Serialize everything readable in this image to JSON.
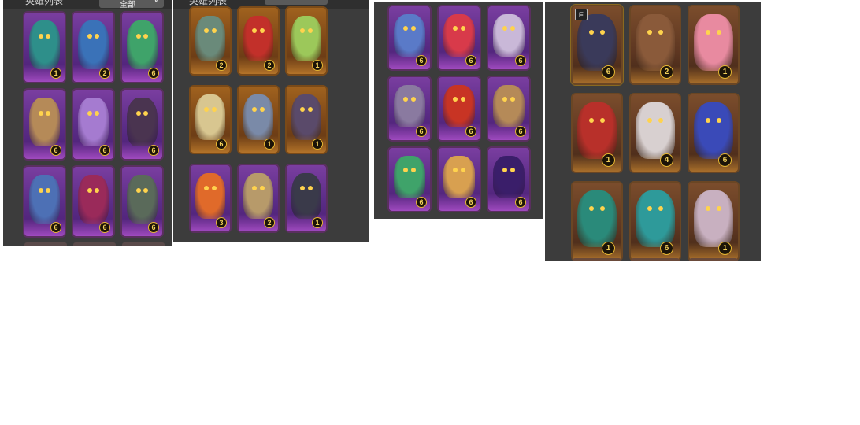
{
  "panels": [
    {
      "id": "panel-0",
      "header": {
        "title": "英雄列表",
        "dropdown": "全部"
      },
      "cards": [
        {
          "character": "teal-hooded-ghost",
          "count": "1",
          "frame": "purple",
          "color": "#2e8f8a"
        },
        {
          "character": "blue-hooded-ghost",
          "count": "2",
          "frame": "purple",
          "color": "#3a72b8"
        },
        {
          "character": "green-frog-beast",
          "count": "6",
          "frame": "purple",
          "color": "#3fa36a"
        },
        {
          "character": "bandaged-mummy",
          "count": "6",
          "frame": "purple",
          "color": "#b58a58"
        },
        {
          "character": "lilac-bunny-beast",
          "count": "6",
          "frame": "purple",
          "color": "#a57bd0"
        },
        {
          "character": "shadow-horned-wraith",
          "count": "6",
          "frame": "purple",
          "color": "#4a3450"
        },
        {
          "character": "blue-shaggy-beast",
          "count": "6",
          "frame": "purple",
          "color": "#4d70b5"
        },
        {
          "character": "crimson-masked-imp",
          "count": "6",
          "frame": "purple",
          "color": "#9a2a5a"
        },
        {
          "character": "grey-masked-shaman",
          "count": "6",
          "frame": "purple",
          "color": "#5a6a5a"
        }
      ]
    },
    {
      "id": "panel-1",
      "header": {
        "title": "英雄列表",
        "dropdown": ""
      },
      "cards": [
        {
          "character": "horned-gem-warden",
          "count": "2",
          "frame": "gold",
          "color": "#6a8a7a"
        },
        {
          "character": "red-flame-demon",
          "count": "2",
          "frame": "gold",
          "color": "#c2302a"
        },
        {
          "character": "green-fairy-dryad",
          "count": "1",
          "frame": "gold",
          "color": "#9cc85a"
        },
        {
          "character": "silver-haired-priestess",
          "count": "6",
          "frame": "gold",
          "color": "#d8c690"
        },
        {
          "character": "grey-cat-mage",
          "count": "1",
          "frame": "gold",
          "color": "#7a8aa8"
        },
        {
          "character": "dark-armored-knight",
          "count": "1",
          "frame": "gold",
          "color": "#5a4a6a"
        },
        {
          "character": "fire-fox-spirit",
          "count": "3",
          "frame": "purple",
          "color": "#e06a2a"
        },
        {
          "character": "tan-hairy-beast",
          "count": "2",
          "frame": "purple",
          "color": "#b79a6a"
        },
        {
          "character": "dark-hooded-specter",
          "count": "1",
          "frame": "purple",
          "color": "#3a3a4a"
        }
      ]
    },
    {
      "id": "panel-2",
      "header": null,
      "cards": [
        {
          "character": "blue-petal-blob",
          "count": "6",
          "frame": "purple",
          "color": "#5a7ac8"
        },
        {
          "character": "red-petal-blob",
          "count": "6",
          "frame": "purple",
          "color": "#d83a4a"
        },
        {
          "character": "white-haired-ghoul",
          "count": "6",
          "frame": "purple",
          "color": "#c9b8d8"
        },
        {
          "character": "grey-petal-blob",
          "count": "6",
          "frame": "purple",
          "color": "#8a7aa0"
        },
        {
          "character": "red-goggled-imp",
          "count": "6",
          "frame": "purple",
          "color": "#c83424"
        },
        {
          "character": "bandaged-mummy",
          "count": "6",
          "frame": "purple",
          "color": "#b58a58"
        },
        {
          "character": "green-frog-beast",
          "count": "6",
          "frame": "purple",
          "color": "#3fa36a"
        },
        {
          "character": "tan-frog-beast",
          "count": "6",
          "frame": "purple",
          "color": "#d8a050"
        },
        {
          "character": "violet-hooded-specter",
          "count": "6",
          "frame": "purple",
          "color": "#3a1e6a"
        }
      ]
    },
    {
      "id": "panel-3",
      "header": null,
      "cards": [
        {
          "character": "shadow-white-haired-lord",
          "count": "6",
          "frame": "brown",
          "color": "#3a3a5a",
          "selected": true,
          "tag": "E"
        },
        {
          "character": "dark-skinned-warrior-queen",
          "count": "2",
          "frame": "brown",
          "color": "#8a5a3a"
        },
        {
          "character": "pink-haired-gunner",
          "count": "1",
          "frame": "brown",
          "color": "#e88aa0"
        },
        {
          "character": "crimson-headdress-empress",
          "count": "1",
          "frame": "brown",
          "color": "#b8302a"
        },
        {
          "character": "white-haired-sorceress",
          "count": "4",
          "frame": "brown",
          "color": "#d8d0d0"
        },
        {
          "character": "blue-haired-halo-priestess",
          "count": "6",
          "frame": "brown",
          "color": "#3a4ab8"
        },
        {
          "character": "red-teal-horned-fighter",
          "count": "1",
          "frame": "brown",
          "color": "#2a8a7a"
        },
        {
          "character": "teal-crowned-monkey-king",
          "count": "6",
          "frame": "brown",
          "color": "#2e9a9a"
        },
        {
          "character": "silver-haired-dancer",
          "count": "1",
          "frame": "brown",
          "color": "#c8b0c0"
        }
      ]
    }
  ]
}
